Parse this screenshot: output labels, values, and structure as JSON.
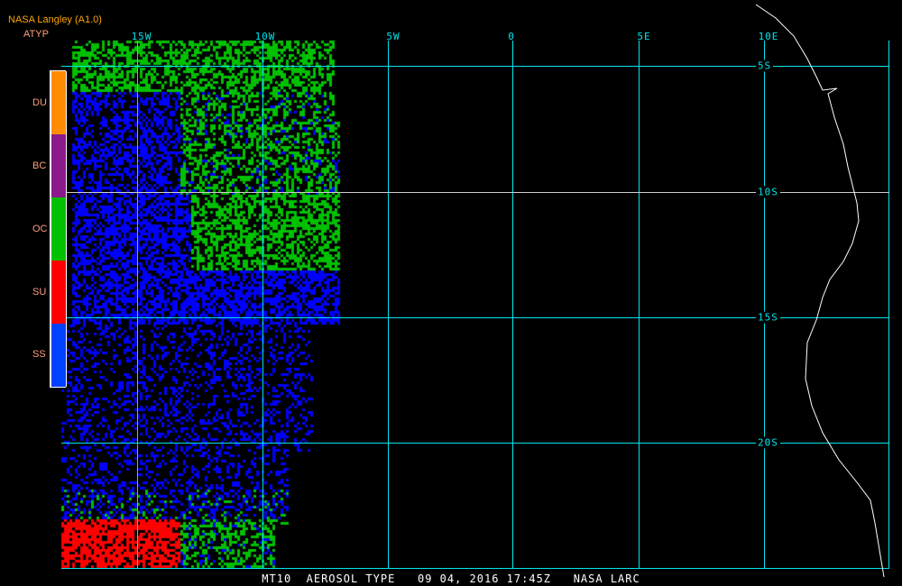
{
  "header": {
    "title": "NASA Langley (A1.0)",
    "product": "ATYP"
  },
  "legend": [
    {
      "label": "DU",
      "color": "#ff8c00"
    },
    {
      "label": "BC",
      "color": "#8b1a8b"
    },
    {
      "label": "OC",
      "color": "#00c000"
    },
    {
      "label": "SU",
      "color": "#ff0000"
    },
    {
      "label": "SS",
      "color": "#0040ff"
    }
  ],
  "longitudes": [
    "15W",
    "10W",
    "5W",
    "0",
    "5E",
    "10E"
  ],
  "latitudes": [
    "5S",
    "10S",
    "15S",
    "20S"
  ],
  "footer": "MT10  AEROSOL TYPE   09 04, 2016 17:45Z   NASA LARC",
  "colors": {
    "grid": "#00e5ee",
    "coast": "#ffffff"
  }
}
